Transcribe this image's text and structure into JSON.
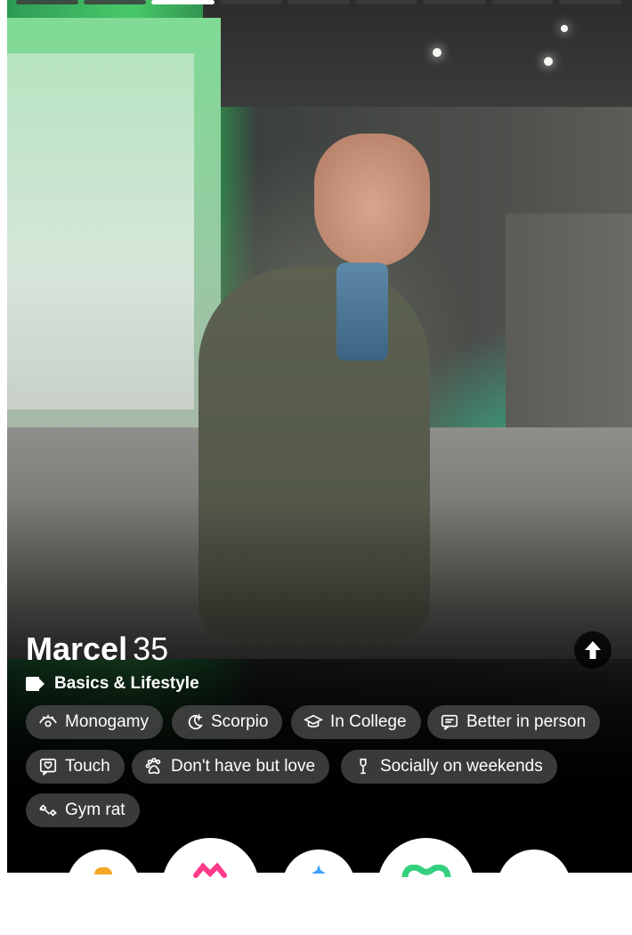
{
  "profile": {
    "name": "Marcel",
    "age": "35",
    "section_title": "Basics & Lifestyle",
    "photo_count": 9,
    "active_photo": 3
  },
  "chips": [
    {
      "label": "Monogamy",
      "icon": "eye-icon"
    },
    {
      "label": "Scorpio",
      "icon": "moon-icon"
    },
    {
      "label": "In College",
      "icon": "graduation-cap-icon"
    },
    {
      "label": "Better in person",
      "icon": "chat-bubble-icon"
    },
    {
      "label": "Touch",
      "icon": "heart-chat-icon"
    },
    {
      "label": "Don't have but love",
      "icon": "paw-icon"
    },
    {
      "label": "Socially on weekends",
      "icon": "glass-icon"
    },
    {
      "label": "Gym rat",
      "icon": "dumbbell-icon"
    }
  ],
  "actions": [
    {
      "name": "rewind-button",
      "icon": "rewind-icon",
      "color": "#f5a623"
    },
    {
      "name": "nope-button",
      "icon": "x-icon",
      "color": "#ff3b8a"
    },
    {
      "name": "super-like-button",
      "icon": "star-icon",
      "color": "#3aa0ff"
    },
    {
      "name": "like-button",
      "icon": "heart-icon",
      "color": "#35d07f"
    },
    {
      "name": "boost-button",
      "icon": "lightning-icon",
      "color": "#a05cff"
    }
  ],
  "colors": {
    "chip_bg": "#505050",
    "progress_active": "#ffffff",
    "progress_inactive": "#3c3c3c"
  }
}
